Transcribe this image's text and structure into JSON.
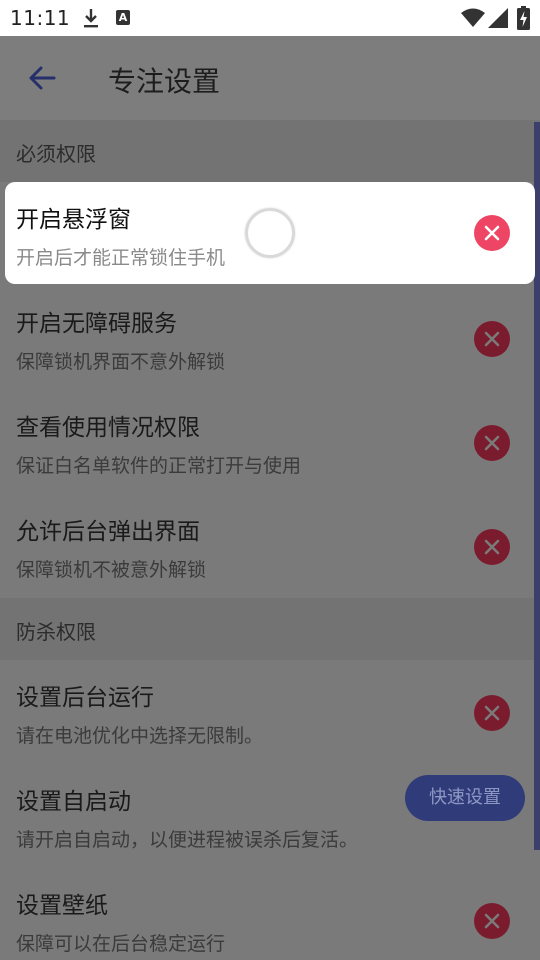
{
  "status_bar": {
    "time": "11:11",
    "notification_a": "A"
  },
  "app_bar": {
    "title": "专注设置"
  },
  "sections": {
    "required": {
      "label": "必须权限"
    },
    "protect": {
      "label": "防杀权限"
    }
  },
  "permissions": [
    {
      "title": "开启悬浮窗",
      "subtitle": "开启后才能正常锁住手机"
    },
    {
      "title": "开启无障碍服务",
      "subtitle": "保障锁机界面不意外解锁"
    },
    {
      "title": "查看使用情况权限",
      "subtitle": "保证白名单软件的正常打开与使用"
    },
    {
      "title": "允许后台弹出界面",
      "subtitle": "保障锁机不被意外解锁"
    }
  ],
  "protections": [
    {
      "title": "设置后台运行",
      "subtitle": "请在电池优化中选择无限制。"
    },
    {
      "title": "设置自启动",
      "subtitle": "请开启自启动，以便进程被误杀后复活。"
    },
    {
      "title": "设置壁纸",
      "subtitle": "保障可以在后台稳定运行"
    }
  ],
  "quick_setup": {
    "label": "快速设置"
  },
  "colors": {
    "accent": "#3f51b5",
    "error": "#ee4565",
    "scrim": "#7a7a7a"
  }
}
